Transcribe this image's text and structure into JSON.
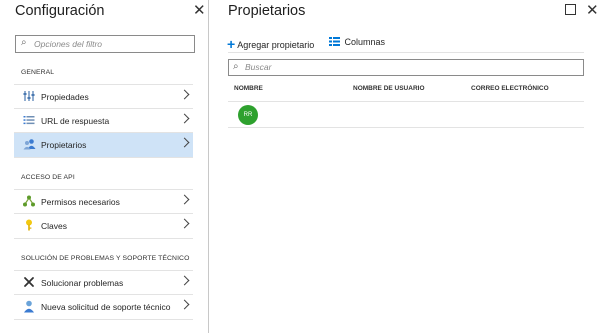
{
  "left_blade": {
    "title": "Configuración",
    "filter_placeholder": "Opciones del filtro",
    "sections": [
      {
        "title": "GENERAL",
        "items": [
          {
            "label": "Propiedades",
            "icon": "properties-icon"
          },
          {
            "label": "URL de respuesta",
            "icon": "list-icon"
          },
          {
            "label": "Propietarios",
            "icon": "owners-icon",
            "selected": true
          }
        ]
      },
      {
        "title": "ACCESO DE API",
        "items": [
          {
            "label": "Permisos necesarios",
            "icon": "permissions-icon"
          },
          {
            "label": "Claves",
            "icon": "key-icon"
          }
        ]
      },
      {
        "title": "SOLUCIÓN DE PROBLEMAS Y SOPORTE TÉCNICO",
        "items": [
          {
            "label": "Solucionar problemas",
            "icon": "tools-icon"
          },
          {
            "label": "Nueva solicitud de soporte técnico",
            "icon": "support-icon"
          }
        ]
      }
    ]
  },
  "right_blade": {
    "title": "Propietarios",
    "toolbar": {
      "add_label": "Agregar propietario",
      "columns_label": "Columnas"
    },
    "search_placeholder": "Buscar",
    "table": {
      "headers": [
        "NOMBRE",
        "NOMBRE DE USUARIO",
        "CORREO ELECTRÓNICO"
      ],
      "rows": [
        {
          "avatar_initials": "RR",
          "name": "",
          "username": "",
          "email": ""
        }
      ]
    }
  },
  "colors": {
    "accent": "#0078d7",
    "selected_bg": "#cfe3f7",
    "avatar_bg": "#2ea12e"
  }
}
